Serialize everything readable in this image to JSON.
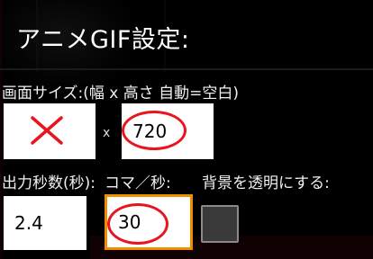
{
  "dialog": {
    "title": "アニメGIF設定:"
  },
  "size": {
    "label": "画面サイズ:(幅 x 高さ 自動=空白)",
    "width_value": "",
    "separator": "x",
    "height_value": "720"
  },
  "timing": {
    "seconds_label": "出力秒数(秒):",
    "seconds_value": "2.4",
    "fps_label": "コマ／秒:",
    "fps_value": "30"
  },
  "background": {
    "label": "背景を透明にする:",
    "checked": false
  },
  "colors": {
    "annotation_red": "#e8141e",
    "focus_orange": "#f08c00"
  }
}
